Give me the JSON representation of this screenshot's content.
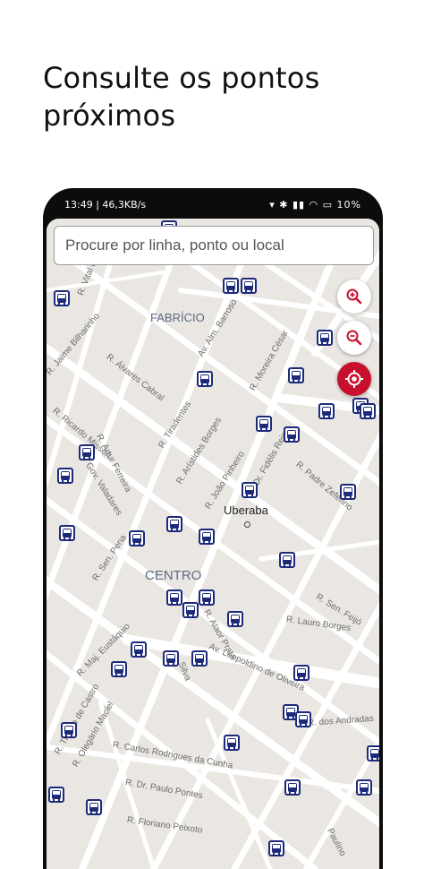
{
  "headline": "Consulte os pontos próximos",
  "status_bar": {
    "time_info": "13:49 | 46,3KB/s",
    "alarm_icon": "alarm-icon",
    "battery": "10%"
  },
  "search": {
    "placeholder": "Procure por linha, ponto ou local"
  },
  "controls": {
    "zoom_in_icon": "zoom-in-icon",
    "zoom_out_icon": "zoom-out-icon",
    "locate_icon": "locate-icon"
  },
  "colors": {
    "accent": "#c8102e",
    "stop": "#1d2a7a",
    "map_bg": "#eae7e2",
    "road": "#ffffff"
  },
  "map": {
    "districts": [
      "FABRÍCIO",
      "CENTRO"
    ],
    "city": "Uberaba",
    "streets": [
      "R. Vital de",
      "R. Jaime Bilharinho",
      "R. Ricardo Misson",
      "R. Álvares Cabral",
      "R. Tiradentes",
      "R. Arístides Borges",
      "Av. Alm. Barroso",
      "R. Moreira César",
      "Gov. Valadares",
      "R. Artur Ferreira",
      "R. João Pinheiro",
      "Dr. Fidélis Reis",
      "R. Padre Zeferino",
      "R. Sen. Pena",
      "R. Alaor Prata",
      "R. Lauro Borges",
      "R. Sen. Feijó",
      "Av. Leopoldino de Oliveira",
      "R. Maj. Eustáquio",
      "R. Tristão de Castro",
      "R. Olegário Maciel",
      "R. Carlos Rodrigues da Cunha",
      "R. dos Andradas",
      "R. Dr. Paulo Pontes",
      "R. Floriano Peixoto",
      "Paulino",
      "Silva"
    ]
  }
}
